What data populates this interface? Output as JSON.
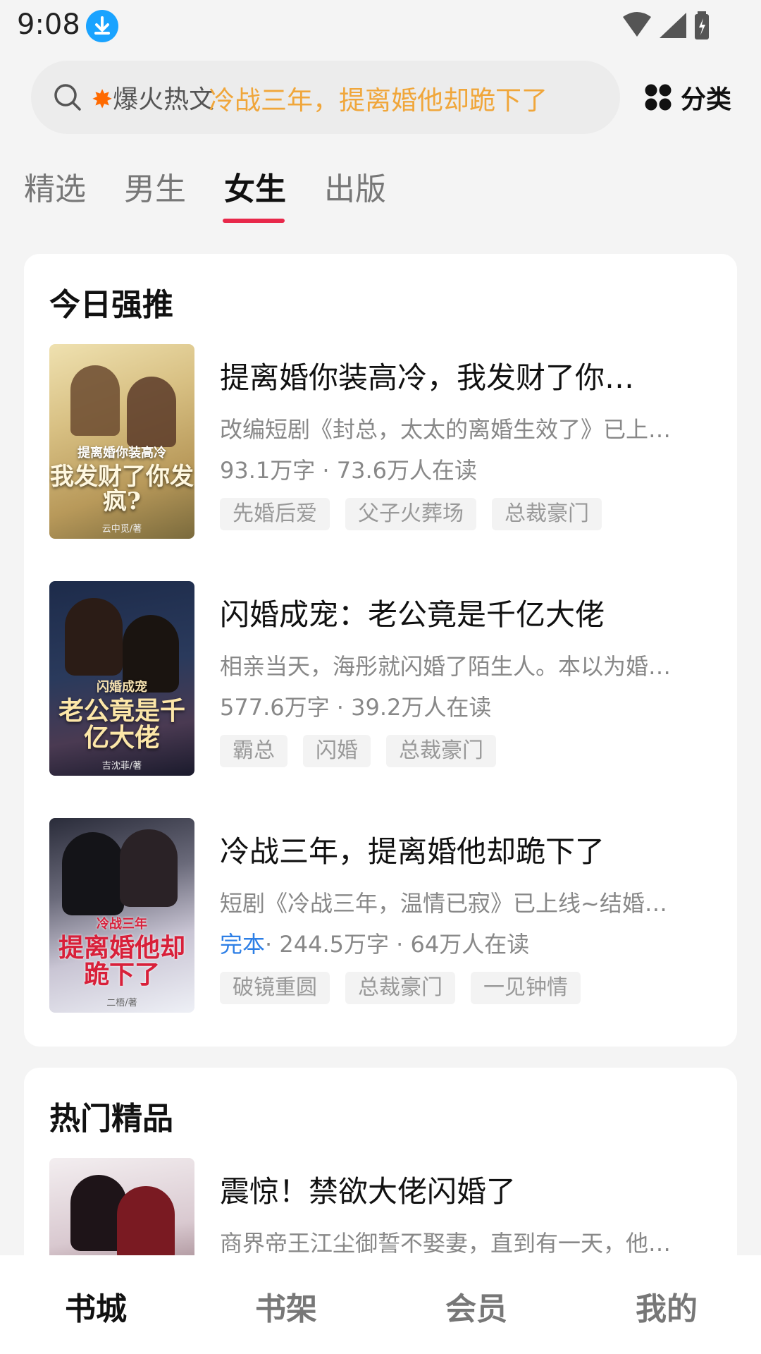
{
  "status_bar": {
    "time": "9:08",
    "icons": [
      "download-icon",
      "wifi-icon",
      "signal-icon",
      "battery-icon"
    ]
  },
  "search": {
    "hot_label": "爆火热文",
    "suggestion": "冷战三年，提离婚他却跪下了",
    "category_label": "分类"
  },
  "tabs": [
    {
      "label": "精选",
      "active": false
    },
    {
      "label": "男生",
      "active": false
    },
    {
      "label": "女生",
      "active": true
    },
    {
      "label": "出版",
      "active": false
    }
  ],
  "sections": [
    {
      "title": "今日强推",
      "books": [
        {
          "title": "提离婚你装高冷，我发财了你…",
          "desc": "改编短剧《封总，太太的离婚生效了》已上…",
          "meta": "93.1万字 · 73.6万人在读",
          "completed": "",
          "tags": [
            "先婚后爱",
            "父子火葬场",
            "总裁豪门"
          ],
          "cover": {
            "top": "提离婚你装高冷",
            "main": "我发财了你发疯?",
            "author": "云中觅/著"
          }
        },
        {
          "title": "闪婚成宠：老公竟是千亿大佬",
          "desc": "相亲当天，海彤就闪婚了陌生人。本以为婚…",
          "meta": "577.6万字 · 39.2万人在读",
          "completed": "",
          "tags": [
            "霸总",
            "闪婚",
            "总裁豪门"
          ],
          "cover": {
            "top": "闪婚成宠",
            "main": "老公竟是千亿大佬",
            "author": "吉沈菲/著"
          }
        },
        {
          "title": "冷战三年，提离婚他却跪下了",
          "desc": "短剧《冷战三年，温情已寂》已上线~结婚…",
          "meta": "· 244.5万字 · 64万人在读",
          "completed": "完本",
          "tags": [
            "破镜重圆",
            "总裁豪门",
            "一见钟情"
          ],
          "cover": {
            "top": "冷战三年",
            "main": "提离婚他却跪下了",
            "author": "二梧/著"
          }
        }
      ]
    },
    {
      "title": "热门精品",
      "books": [
        {
          "title": "震惊！禁欲大佬闪婚了",
          "desc": "商界帝王江尘御誓不娶妻，直到有一天，他…"
        }
      ]
    }
  ],
  "bottom_nav": [
    {
      "label": "书城",
      "active": true
    },
    {
      "label": "书架",
      "active": false
    },
    {
      "label": "会员",
      "active": false
    },
    {
      "label": "我的",
      "active": false
    }
  ],
  "colors": {
    "accent": "#e8284a",
    "suggestion": "#f0a63a",
    "completed": "#2d7fe6"
  }
}
